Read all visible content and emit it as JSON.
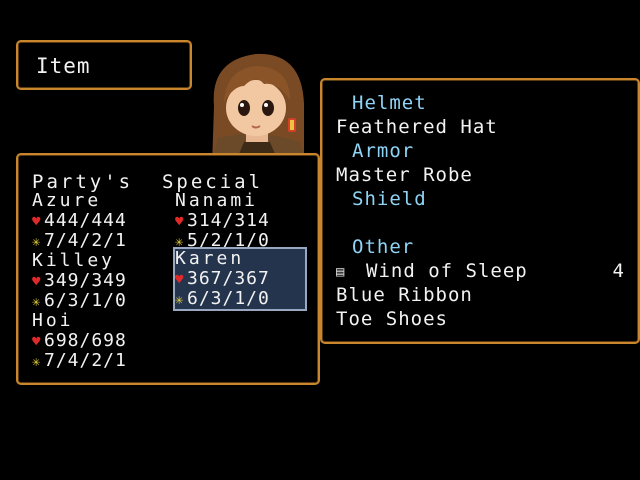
{
  "title": "Item",
  "party": {
    "heading": "Party's  Special",
    "members": [
      {
        "name": "Azure",
        "hp": "444/444",
        "mp": "7/4/2/1",
        "selected": false
      },
      {
        "name": "Nanami",
        "hp": "314/314",
        "mp": "5/2/1/0",
        "selected": false
      },
      {
        "name": "Killey",
        "hp": "349/349",
        "mp": "6/3/1/0",
        "selected": false
      },
      {
        "name": "Karen",
        "hp": "367/367",
        "mp": "6/3/1/0",
        "selected": true
      },
      {
        "name": "Hoi",
        "hp": "698/698",
        "mp": "7/4/2/1",
        "selected": false
      }
    ]
  },
  "equipment": {
    "helmet_label": "Helmet",
    "helmet": "Feathered Hat",
    "armor_label": "Armor",
    "armor": "Master Robe",
    "shield_label": "Shield",
    "shield": "",
    "other_label": "Other",
    "other": [
      {
        "name": "Wind of Sleep",
        "count": "4",
        "icon": "book-icon"
      },
      {
        "name": "Blue Ribbon",
        "count": ""
      },
      {
        "name": "Toe Shoes",
        "count": ""
      }
    ]
  },
  "icons": {
    "hp": "heart-icon",
    "mp": "star-icon"
  },
  "colors": {
    "border": "#c9862c",
    "label": "#8fd4f5",
    "selection": "#25344d",
    "heart": "#e02a2a",
    "star": "#e8d23a"
  }
}
